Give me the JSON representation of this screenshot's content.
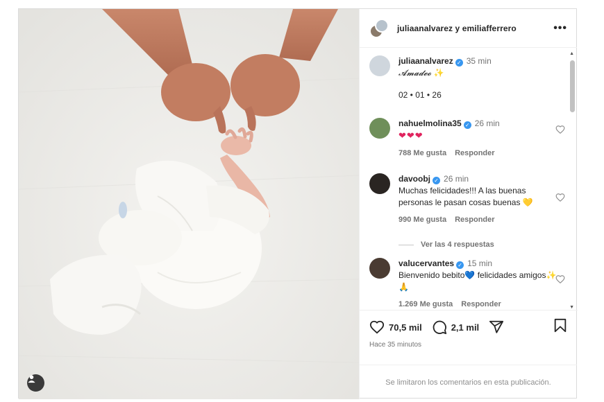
{
  "header": {
    "names": "juliaanalvarez y emiliafferrero",
    "more_label": "•••"
  },
  "caption": {
    "username": "juliaanalvarez",
    "time": "35 min",
    "line1": "𝓐𝓶𝓪𝓭𝓮𝓸",
    "sparkle": "✨",
    "line2": "02 • 01 • 26"
  },
  "comments": [
    {
      "username": "nahuelmolina35",
      "time": "26 min",
      "text": "❤❤❤",
      "likes": "788 Me gusta",
      "reply": "Responder"
    },
    {
      "username": "davoobj",
      "time": "26 min",
      "text": "Muchas felicidades!!! A las buenas personas le pasan cosas buenas",
      "emoji": "💛",
      "likes": "990 Me gusta",
      "reply": "Responder"
    },
    {
      "username": "valucervantes",
      "time": "15 min",
      "text_a": "Bienvenido bebito",
      "emoji_a": "💙",
      "text_b": "felicidades amigos",
      "emoji_b": "✨🙏",
      "likes": "1.269 Me gusta",
      "reply": "Responder"
    }
  ],
  "view_replies": "Ver las 4 respuestas",
  "actions": {
    "likes": "70,5 mil",
    "comments": "2,1 mil"
  },
  "posted_ago": "Hace 35 minutos",
  "footer_note": "Se limitaron los comentarios en esta publicación."
}
